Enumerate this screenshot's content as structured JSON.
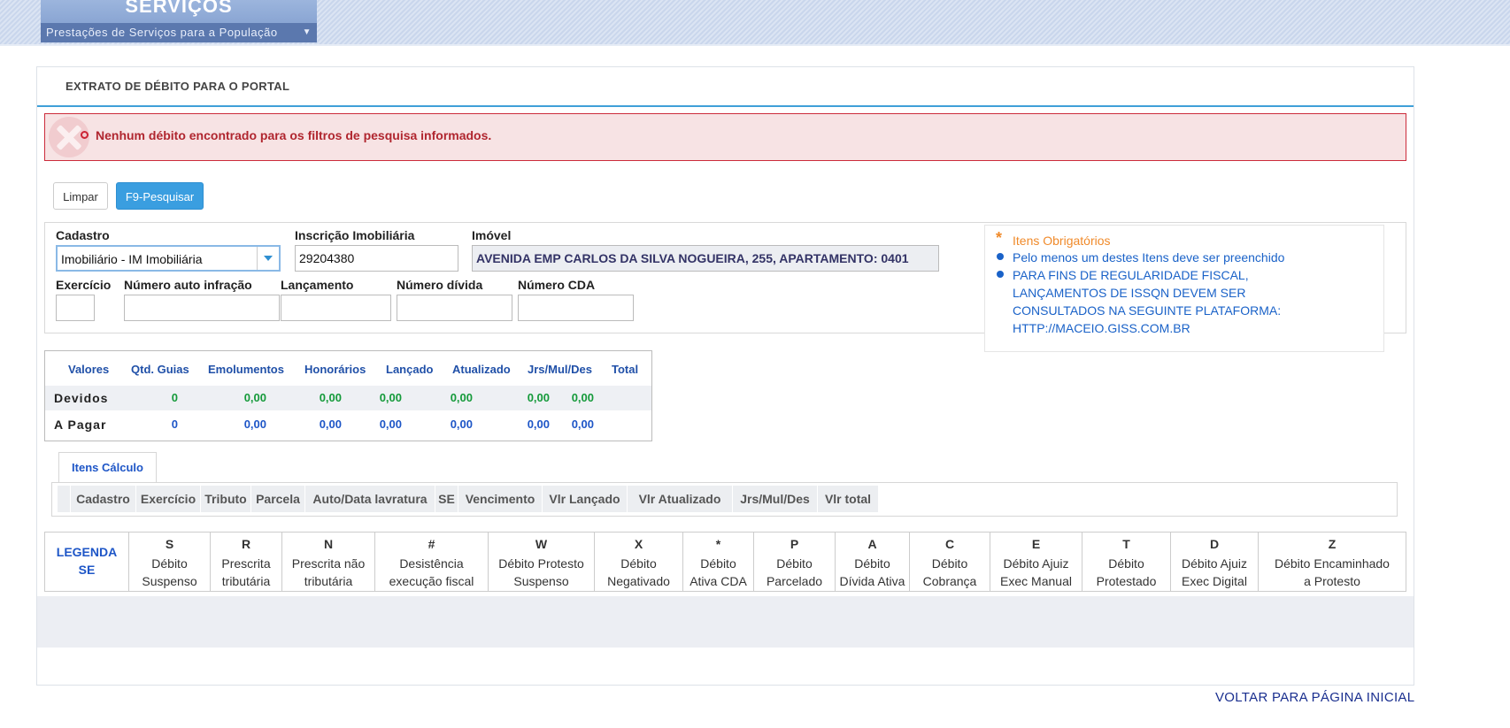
{
  "header": {
    "brand_title": "SERVIÇOS",
    "brand_subtitle": "Prestações de Serviços para a População"
  },
  "panel": {
    "title": "EXTRATO DE DÉBITO PARA O PORTAL"
  },
  "alert": {
    "message": "Nenhum débito encontrado para os filtros de pesquisa informados."
  },
  "toolbar": {
    "clear_label": "Limpar",
    "search_label": "F9-Pesquisar"
  },
  "filters": {
    "cadastro": {
      "label": "Cadastro",
      "value": "Imobiliário - IM Imobiliária"
    },
    "inscricao": {
      "label": "Inscrição Imobiliária",
      "value": "29204380"
    },
    "imovel": {
      "label": "Imóvel",
      "value": "AVENIDA EMP CARLOS DA SILVA NOGUEIRA, 255, APARTAMENTO: 0401"
    },
    "exercicio": {
      "label": "Exercício",
      "value": ""
    },
    "auto_infracao": {
      "label": "Número auto infração",
      "value": ""
    },
    "lancamento": {
      "label": "Lançamento",
      "value": ""
    },
    "divida": {
      "label": "Número dívida",
      "value": ""
    },
    "cda": {
      "label": "Número CDA",
      "value": ""
    }
  },
  "legend_info": {
    "required": "Itens Obrigatórios",
    "at_least_one": "Pelo menos um destes Itens deve ser preenchido",
    "notice_lines": [
      "PARA FINS DE REGULARIDADE FISCAL,",
      "LANÇAMENTOS DE ISSQN DEVEM SER",
      "CONSULTADOS NA SEGUINTE PLATAFORMA:",
      "HTTP://MACEIO.GISS.COM.BR"
    ]
  },
  "values_table": {
    "headers": [
      "Valores",
      "Qtd. Guias",
      "Emolumentos",
      "Honorários",
      "Lançado",
      "Atualizado",
      "Jrs/Mul/Des",
      "Total"
    ],
    "rows": [
      {
        "label": "Devidos",
        "cells": [
          "0",
          "0,00",
          "0,00",
          "0,00",
          "0,00",
          "0,00",
          "0,00"
        ]
      },
      {
        "label": "A Pagar",
        "cells": [
          "0",
          "0,00",
          "0,00",
          "0,00",
          "0,00",
          "0,00",
          "0,00"
        ]
      }
    ]
  },
  "calc_tab": {
    "label": "Itens Cálculo"
  },
  "calc_columns": [
    "Cadastro",
    "Exercício",
    "Tributo",
    "Parcela",
    "Auto/Data lavratura",
    "SE",
    "Vencimento",
    "Vlr Lançado",
    "Vlr Atualizado",
    "Jrs/Mul/Des",
    "Vlr total"
  ],
  "legenda": {
    "title_lines": [
      "LEGENDA",
      "SE"
    ],
    "items": [
      {
        "code": "S",
        "lines": [
          "Débito",
          "Suspenso"
        ]
      },
      {
        "code": "R",
        "lines": [
          "Prescrita",
          "tributária"
        ]
      },
      {
        "code": "N",
        "lines": [
          "Prescrita não",
          "tributária"
        ]
      },
      {
        "code": "#",
        "lines": [
          "Desistência",
          "execução fiscal"
        ]
      },
      {
        "code": "W",
        "lines": [
          "Débito Protesto",
          "Suspenso"
        ]
      },
      {
        "code": "X",
        "lines": [
          "Débito",
          "Negativado"
        ]
      },
      {
        "code": "*",
        "lines": [
          "Débito",
          "Ativa CDA"
        ]
      },
      {
        "code": "P",
        "lines": [
          "Débito",
          "Parcelado"
        ]
      },
      {
        "code": "A",
        "lines": [
          "Débito",
          "Dívida Ativa"
        ]
      },
      {
        "code": "C",
        "lines": [
          "Débito",
          "Cobrança"
        ]
      },
      {
        "code": "E",
        "lines": [
          "Débito Ajuiz",
          "Exec Manual"
        ]
      },
      {
        "code": "T",
        "lines": [
          "Débito",
          "Protestado"
        ]
      },
      {
        "code": "D",
        "lines": [
          "Débito Ajuiz",
          "Exec Digital"
        ]
      },
      {
        "code": "Z",
        "lines": [
          "Débito Encaminhado",
          "a Protesto"
        ]
      }
    ]
  },
  "footer": {
    "back_link": "VOLTAR PARA PÁGINA INICIAL"
  },
  "colors": {
    "accent": "#3a9ee0",
    "alert_bg": "#f7e3e4",
    "alert_text": "#b0262f",
    "required": "#f08a2a",
    "info": "#1a62c8"
  }
}
